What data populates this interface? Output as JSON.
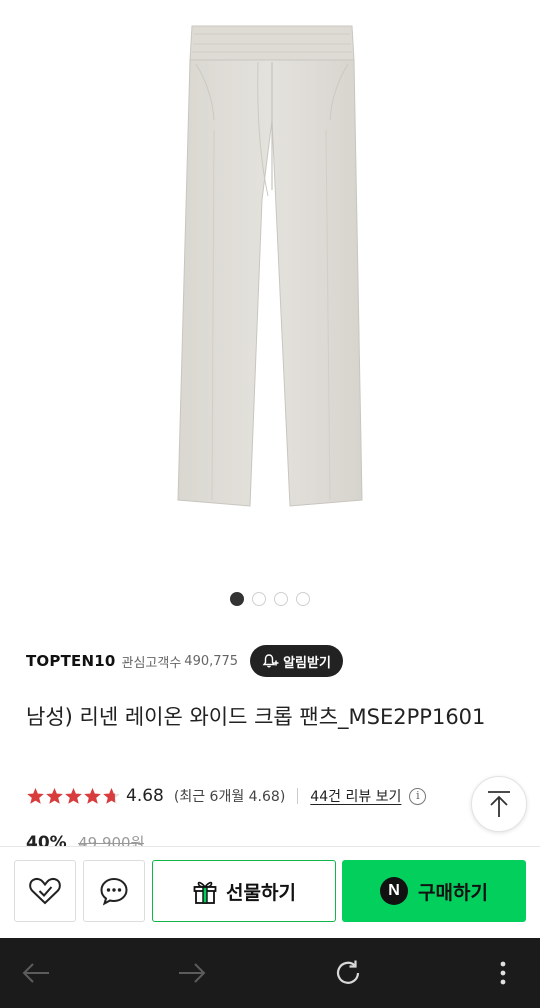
{
  "gallery": {
    "image_icon": "linen-wide-crop-pants-product-photo",
    "pages_total": 4,
    "current_page": 1
  },
  "brand": {
    "name": "TOPTEN10",
    "fans_label": "관심고객수",
    "fans_count": "490,775",
    "alarm_label": "알림받기",
    "alarm_icon": "bell-plus-icon"
  },
  "product": {
    "title": "남성) 리넨 레이온 와이드 크롭 팬츠_MSE2PP1601"
  },
  "rating": {
    "stars": 4.68,
    "value": "4.68",
    "recent": "(최근 6개월 4.68)",
    "review_link": "44건 리뷰 보기",
    "info_icon": "info-icon",
    "star_color": "#d83c3c"
  },
  "price": {
    "discount": "40%",
    "original": "49,900원"
  },
  "actions": {
    "zzim_icon": "heart-check-icon",
    "talk_icon": "chat-bubble-icon",
    "gift_label": "선물하기",
    "gift_icon": "gift-icon",
    "buy_label": "구매하기",
    "buy_badge": "N",
    "accent": "#03cf5d"
  },
  "browser_nav": {
    "back_icon": "arrow-left-icon",
    "forward_icon": "arrow-right-icon",
    "reload_icon": "reload-icon",
    "menu_icon": "more-vertical-icon"
  },
  "scroll_top_icon": "arrow-up-to-top-icon"
}
